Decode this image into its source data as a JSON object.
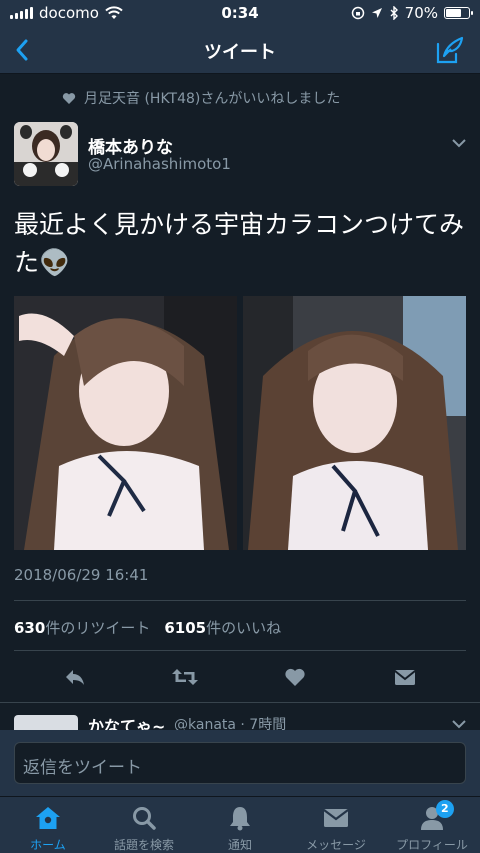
{
  "status_bar": {
    "carrier": "docomo",
    "time": "0:34",
    "battery_percent": "70%",
    "battery_level": 0.7
  },
  "navbar": {
    "title": "ツイート",
    "back_icon": "chevron-left-icon",
    "compose_icon": "compose-tweet-icon"
  },
  "tweet": {
    "social_context": "月足天音 (HKT48)さんがいいねしました",
    "author": {
      "name": "橋本ありな",
      "handle": "@Arinahashimoto1"
    },
    "text": "最近よく見かける宇宙カラコンつけてみた👽",
    "photos": [
      "photo-1",
      "photo-2"
    ],
    "timestamp": "2018/06/29 16:41",
    "retweets": {
      "count": "630",
      "label": "件のリツイート"
    },
    "likes": {
      "count": "6105",
      "label": "件のいいね"
    },
    "actions": [
      "reply-icon",
      "retweet-icon",
      "like-heart-icon",
      "share-message-icon"
    ]
  },
  "reply_peek": {
    "name": "かなてゃ~",
    "meta": "@kanata · 7時間"
  },
  "reply_bar": {
    "placeholder": "返信をツイート"
  },
  "tabbar": {
    "tabs": [
      {
        "label": "ホーム",
        "icon": "home-icon",
        "active": true
      },
      {
        "label": "話題を検索",
        "icon": "search-icon",
        "active": false
      },
      {
        "label": "通知",
        "icon": "bell-icon",
        "active": false
      },
      {
        "label": "メッセージ",
        "icon": "envelope-icon",
        "active": false
      },
      {
        "label": "プロフィール",
        "icon": "profile-icon",
        "active": false,
        "badge": "2"
      }
    ]
  },
  "colors": {
    "background": "#141d26",
    "bar": "#243447",
    "accent": "#1da1f2",
    "muted": "#8899a6"
  }
}
